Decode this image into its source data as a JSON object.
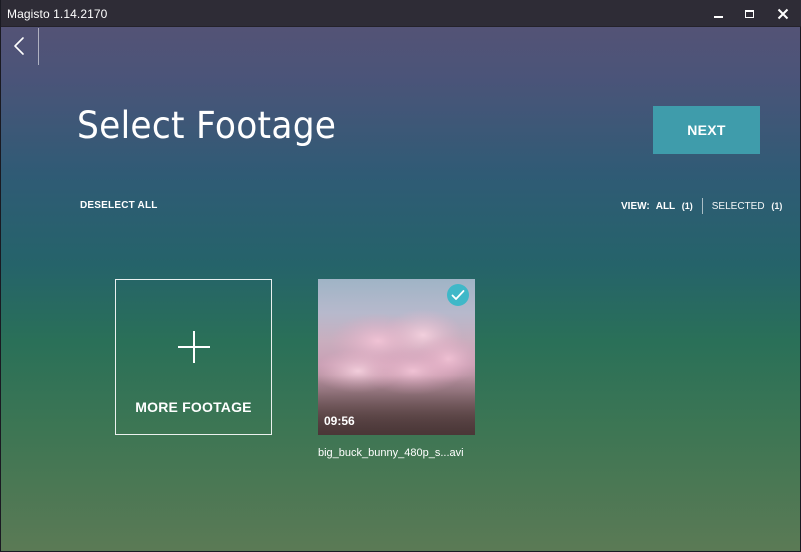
{
  "window": {
    "title": "Magisto 1.14.2170"
  },
  "header": {
    "title": "Select Footage",
    "next_label": "NEXT"
  },
  "toolbar": {
    "deselect_all": "DESELECT ALL",
    "view_label": "VIEW:",
    "view_all": "ALL",
    "view_all_count": "(1)",
    "selected_label": "SELECTED",
    "selected_count": "(1)"
  },
  "grid": {
    "add_tile_label": "MORE FOOTAGE",
    "clips": [
      {
        "name": "big_buck_bunny_480p_s...avi",
        "duration": "09:56",
        "selected": true
      }
    ]
  },
  "icons": {
    "back": "chevron-left-icon",
    "add": "plus-icon",
    "check": "checkmark-icon",
    "minimize": "minimize-icon",
    "maximize": "maximize-icon",
    "close": "close-icon"
  },
  "colors": {
    "accent": "#3f9cab",
    "check": "#3fb8c8",
    "titlebar": "#2e2c36"
  }
}
